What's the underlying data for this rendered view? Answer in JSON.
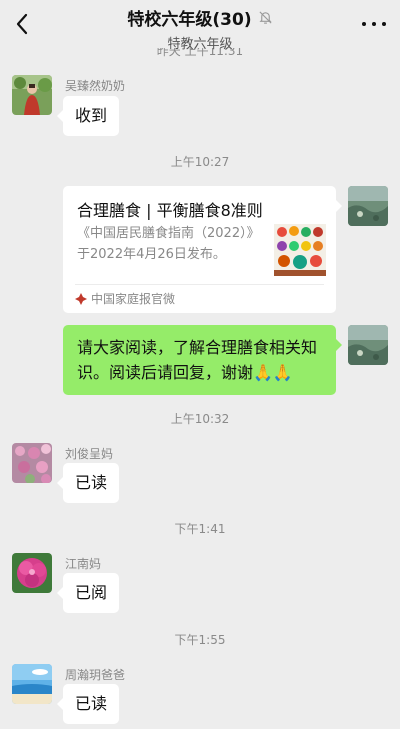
{
  "header": {
    "title": "特校六年级(30)",
    "subtitle": "特教六年级",
    "partial_time": "昨天 上午11:31"
  },
  "messages": {
    "m1": {
      "sender": "吴臻然奶奶",
      "text": "收到"
    },
    "t1": "上午10:27",
    "card": {
      "title": "合理膳食 | 平衡膳食8准则",
      "desc": "《中国居民膳食指南（2022）》于2022年4月26日发布。",
      "source": "中国家庭报官微"
    },
    "self_text": "请大家阅读，了解合理膳食相关知识。阅读后请回复，谢谢🙏🙏",
    "t2": "上午10:32",
    "m2": {
      "sender": "刘俊呈妈",
      "text": "已读"
    },
    "t3": "下午1:41",
    "m3": {
      "sender": "江南妈",
      "text": "已阅"
    },
    "t4": "下午1:55",
    "m4": {
      "sender": "周瀚玥爸爸",
      "text": "已读"
    }
  },
  "icons": {
    "back": "chevron-left-icon",
    "mute": "bell-off-icon",
    "more": "more-dots-icon",
    "source": "brand-logo-icon"
  },
  "colors": {
    "background": "#ededed",
    "self_bubble": "#95ec69",
    "other_bubble": "#ffffff"
  }
}
